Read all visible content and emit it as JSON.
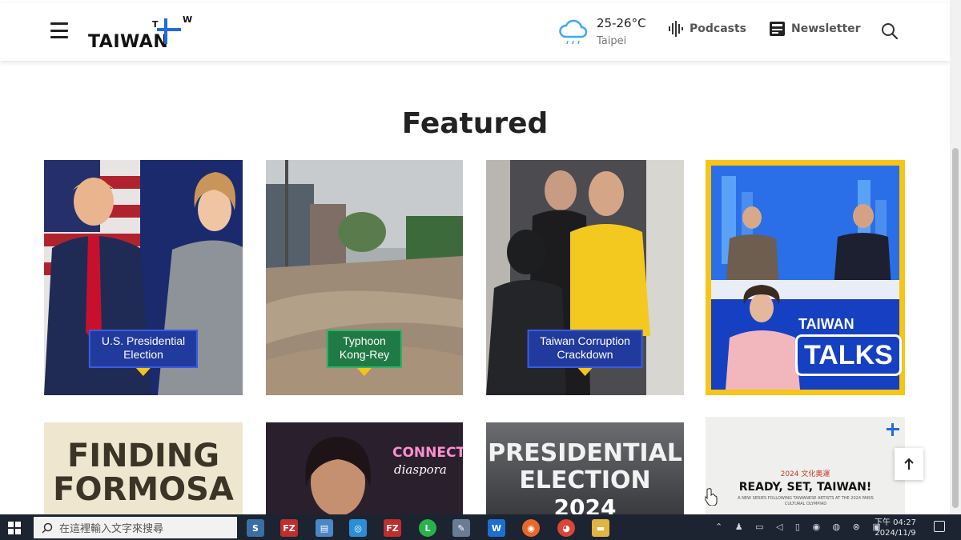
{
  "header": {
    "logo_text": "TAIWAN",
    "weather": {
      "temp": "25-26°C",
      "city": "Taipei"
    },
    "nav": {
      "podcasts": "Podcasts",
      "newsletter": "Newsletter"
    }
  },
  "section_title": "Featured",
  "cards_row1": [
    {
      "tag_line1": "U.S. Presidential",
      "tag_line2": "Election"
    },
    {
      "tag_line1": "Typhoon",
      "tag_line2": "Kong-Rey"
    },
    {
      "tag_line1": "Taiwan Corruption",
      "tag_line2": "Crackdown"
    },
    {
      "title_small": "TAIWAN",
      "title_big": "TALKS"
    }
  ],
  "cards_row2": [
    {
      "line1": "FINDING",
      "line2": "FORMOSA"
    },
    {
      "line1": "CONNECTED",
      "line2": "diaspora"
    },
    {
      "line1": "PRESIDENTIAL",
      "line2": "ELECTION",
      "line3": "2024"
    },
    {
      "kicker": "2024 文化奧運",
      "headline": "READY, SET, TAIWAN!",
      "sub": "A NEW SERIES FOLLOWING TAIWANESE ARTISTS AT THE 2024 PARIS CULTURAL OLYMPIAD"
    }
  ],
  "taskbar": {
    "search_placeholder": "在這裡輸入文字來搜尋",
    "clock_time": "下午 04:27",
    "clock_date": "2024/11/9"
  },
  "colors": {
    "accent": "#1f6be0",
    "tag_blue": "#213a9e",
    "tag_green": "#1f7a45",
    "talks_frame": "#f5c518"
  }
}
